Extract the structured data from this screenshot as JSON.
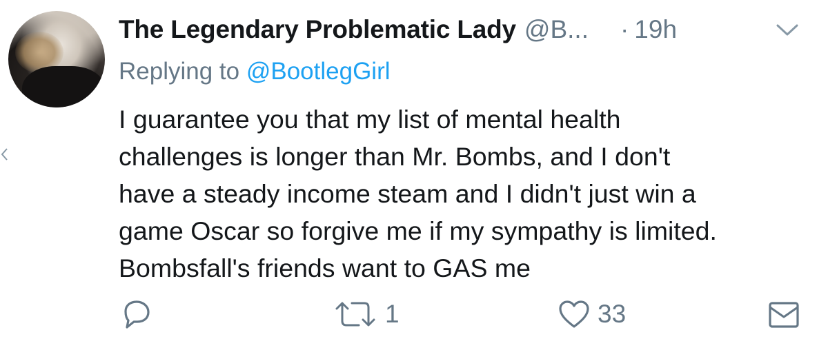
{
  "tweet": {
    "author_name": "The Legendary Problematic Lady",
    "handle": "@B...",
    "separator": "·",
    "timestamp": "19h",
    "replying_prefix": "Replying to ",
    "replying_to": "@BootlegGirl",
    "text": "I guarantee you that my list of mental health\nchallenges is longer than Mr. Bombs, and I don't\nhave a steady income steam and I didn't just win a\ngame Oscar so forgive me if my sympathy is limited.\nBombsfall's friends want to GAS me"
  },
  "actions": {
    "reply_icon": "reply-icon",
    "retweet_icon": "retweet-icon",
    "retweet_count": "1",
    "like_icon": "heart-icon",
    "like_count": "33",
    "message_icon": "envelope-icon"
  },
  "colors": {
    "text": "#14171a",
    "secondary": "#657786",
    "link": "#1da1f2",
    "icon": "#8899a6"
  }
}
